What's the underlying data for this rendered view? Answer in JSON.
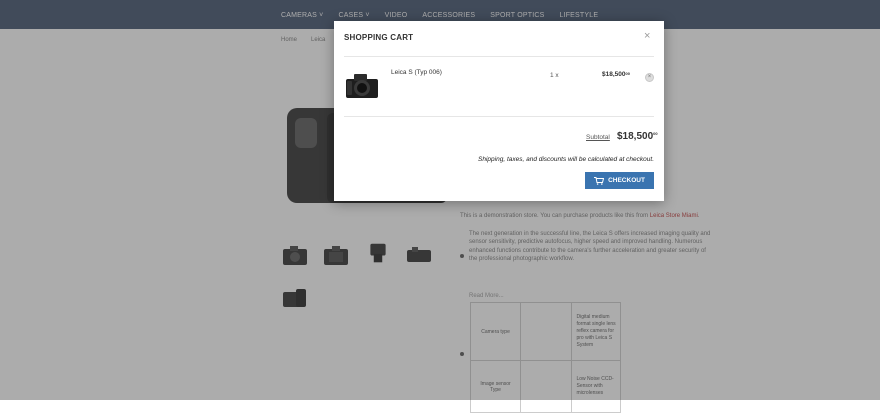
{
  "nav": {
    "items": [
      "CAMERAS ˅",
      "CASES ˅",
      "VIDEO",
      "ACCESSORIES",
      "SPORT OPTICS",
      "LIFESTYLE"
    ]
  },
  "breadcrumb": [
    "Home",
    "Leica"
  ],
  "product": {
    "intro_text": "This is a demonstration store. You can purchase products like this from ",
    "intro_link": "Leica Store Miami",
    "intro_end": ".",
    "description": "The next generation in the successful line, the Leica S offers increased imaging quality and sensor sensitivity, predictive autofocus, higher speed and improved handling. Numerous enhanced functions contribute to the camera's further acceleration and greater security of the professional photographic workflow.",
    "read_more": "Read More...",
    "specs": [
      {
        "label": "Camera type",
        "value": "Digital medium format single lens reflex camera for pro with Leica S System"
      },
      {
        "label": "Image sensor Type",
        "value": "Low Noise CCD-Sensor with microlenses"
      }
    ]
  },
  "cart": {
    "title": "SHOPPING CART",
    "close_icon": "×",
    "item": {
      "name": "Leica S (Typ 006)",
      "qty": "1 x",
      "price_main": "$18,500",
      "price_cents": "00",
      "remove_icon": "×"
    },
    "subtotal_label": "Subtotal",
    "subtotal_main": "$18,500",
    "subtotal_cents": "00",
    "shipping_note": "Shipping, taxes, and discounts will be calculated at checkout.",
    "checkout_label": "CHECKOUT",
    "checkout_icon": "cart-icon"
  },
  "colors": {
    "nav_bg": "#3d4f6b",
    "accent": "#3a74b0"
  }
}
